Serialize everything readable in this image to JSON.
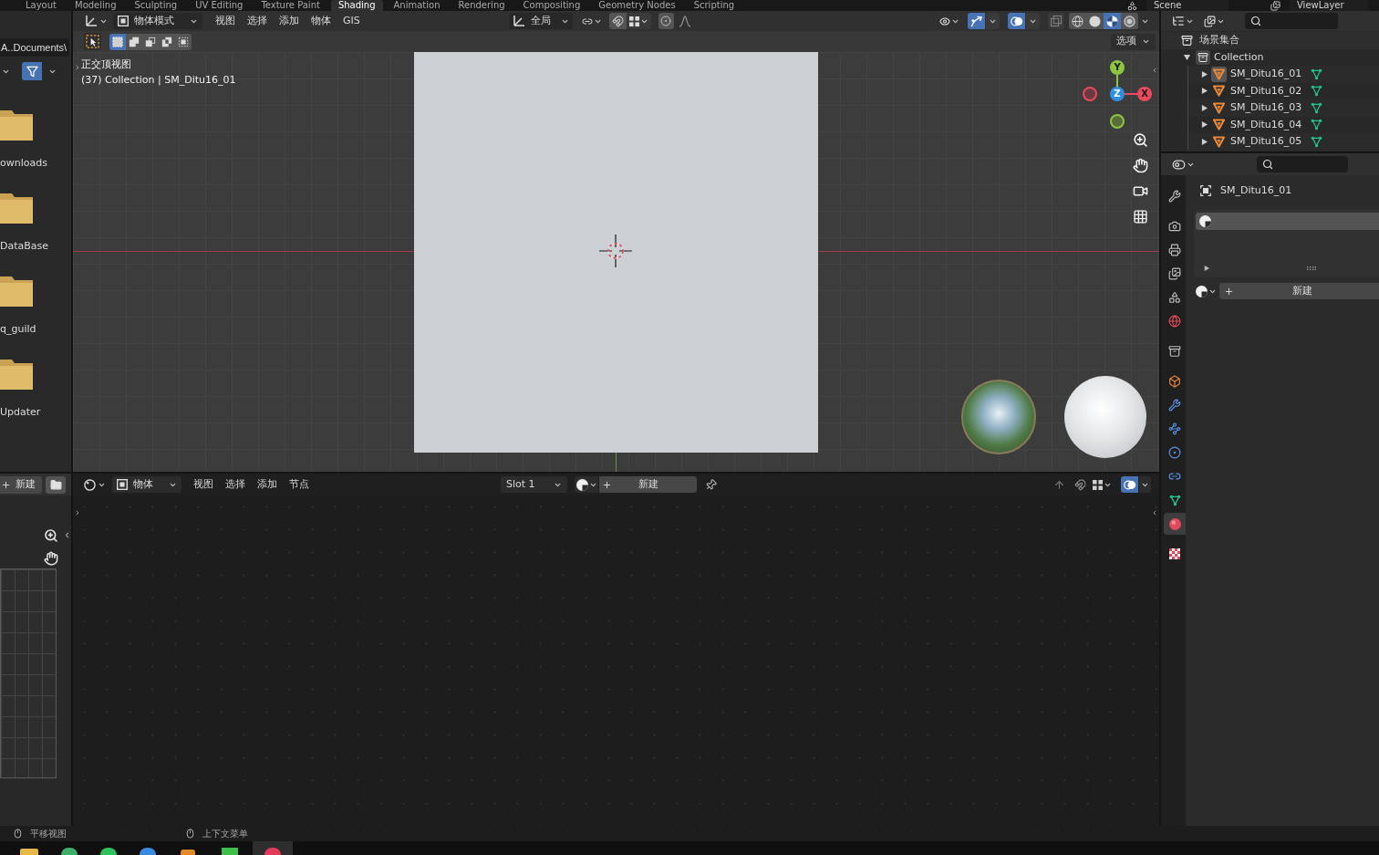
{
  "workspace_tabs": [
    {
      "label": "Layout",
      "selected": false
    },
    {
      "label": "Modeling",
      "selected": false
    },
    {
      "label": "Sculpting",
      "selected": false
    },
    {
      "label": "UV Editing",
      "selected": false
    },
    {
      "label": "Texture Paint",
      "selected": false
    },
    {
      "label": "Shading",
      "selected": true
    },
    {
      "label": "Animation",
      "selected": false
    },
    {
      "label": "Rendering",
      "selected": false
    },
    {
      "label": "Compositing",
      "selected": false
    },
    {
      "label": "Geometry Nodes",
      "selected": false
    },
    {
      "label": "Scripting",
      "selected": false
    }
  ],
  "scene_field": "Scene",
  "view_layer_field": "ViewLayer",
  "file_browser": {
    "path": "A..Documents\\",
    "filter_on": true,
    "folders": [
      {
        "label": "ownloads"
      },
      {
        "label": "DataBase"
      },
      {
        "label": "q_guild"
      },
      {
        "label": "Updater"
      }
    ]
  },
  "image_editor": {
    "new_label": "新建"
  },
  "viewport": {
    "mode": "物体模式",
    "menus": [
      "视图",
      "选择",
      "添加",
      "物体",
      "GIS"
    ],
    "orientation": "全局",
    "gizmos_on": true,
    "overlays_on": true,
    "shading_modes": [
      {
        "kind": "wireframe",
        "selected": false
      },
      {
        "kind": "solid",
        "selected": false
      },
      {
        "kind": "material",
        "selected": true
      },
      {
        "kind": "rendered",
        "selected": false
      }
    ],
    "select_modes": [
      {
        "kind": "set",
        "selected": true
      },
      {
        "kind": "extend",
        "selected": false
      },
      {
        "kind": "subtract",
        "selected": false
      },
      {
        "kind": "difference",
        "selected": false
      },
      {
        "kind": "intersect",
        "selected": false
      }
    ],
    "options": "选项",
    "view_name": "正交顶视图",
    "view_info": "(37) Collection | SM_Ditu16_01",
    "gizmo_axes": [
      {
        "kind": "y",
        "label": "Y"
      },
      {
        "kind": "z",
        "label": "Z"
      },
      {
        "kind": "x",
        "label": "X"
      }
    ]
  },
  "node_editor": {
    "object_type": "物体",
    "menus": [
      "视图",
      "选择",
      "添加",
      "节点"
    ],
    "slot": "Slot 1",
    "new_label": "新建",
    "overlays_on": true
  },
  "outliner": {
    "root": "场景集合",
    "collection": {
      "label": "Collection",
      "expanded": true,
      "children": [
        {
          "label": "SM_Ditu16_01",
          "active": true,
          "expanded": false
        },
        {
          "label": "SM_Ditu16_02",
          "active": false,
          "expanded": false
        },
        {
          "label": "SM_Ditu16_03",
          "active": false,
          "expanded": false
        },
        {
          "label": "SM_Ditu16_04",
          "active": false,
          "expanded": false
        },
        {
          "label": "SM_Ditu16_05",
          "active": false,
          "expanded": false
        }
      ]
    }
  },
  "properties": {
    "tabs": [
      {
        "kind": "tool",
        "selected": false
      },
      {
        "kind": "render",
        "selected": false
      },
      {
        "kind": "output",
        "selected": false
      },
      {
        "kind": "view_layer",
        "selected": false
      },
      {
        "kind": "scene",
        "selected": false
      },
      {
        "kind": "world",
        "selected": false
      },
      {
        "kind": "collection",
        "selected": false
      },
      {
        "kind": "object",
        "selected": false
      },
      {
        "kind": "modifiers",
        "selected": false
      },
      {
        "kind": "particles",
        "selected": false
      },
      {
        "kind": "physics",
        "selected": false
      },
      {
        "kind": "constraints",
        "selected": false
      },
      {
        "kind": "data",
        "selected": false
      },
      {
        "kind": "material",
        "selected": true
      },
      {
        "kind": "texture",
        "selected": false
      }
    ],
    "object": "SM_Ditu16_01",
    "material_slots": [
      {
        "selected": true
      }
    ],
    "new_label": "新建"
  },
  "status_bar": [
    {
      "label": "平移视图"
    },
    {
      "label": "上下文菜单"
    }
  ]
}
